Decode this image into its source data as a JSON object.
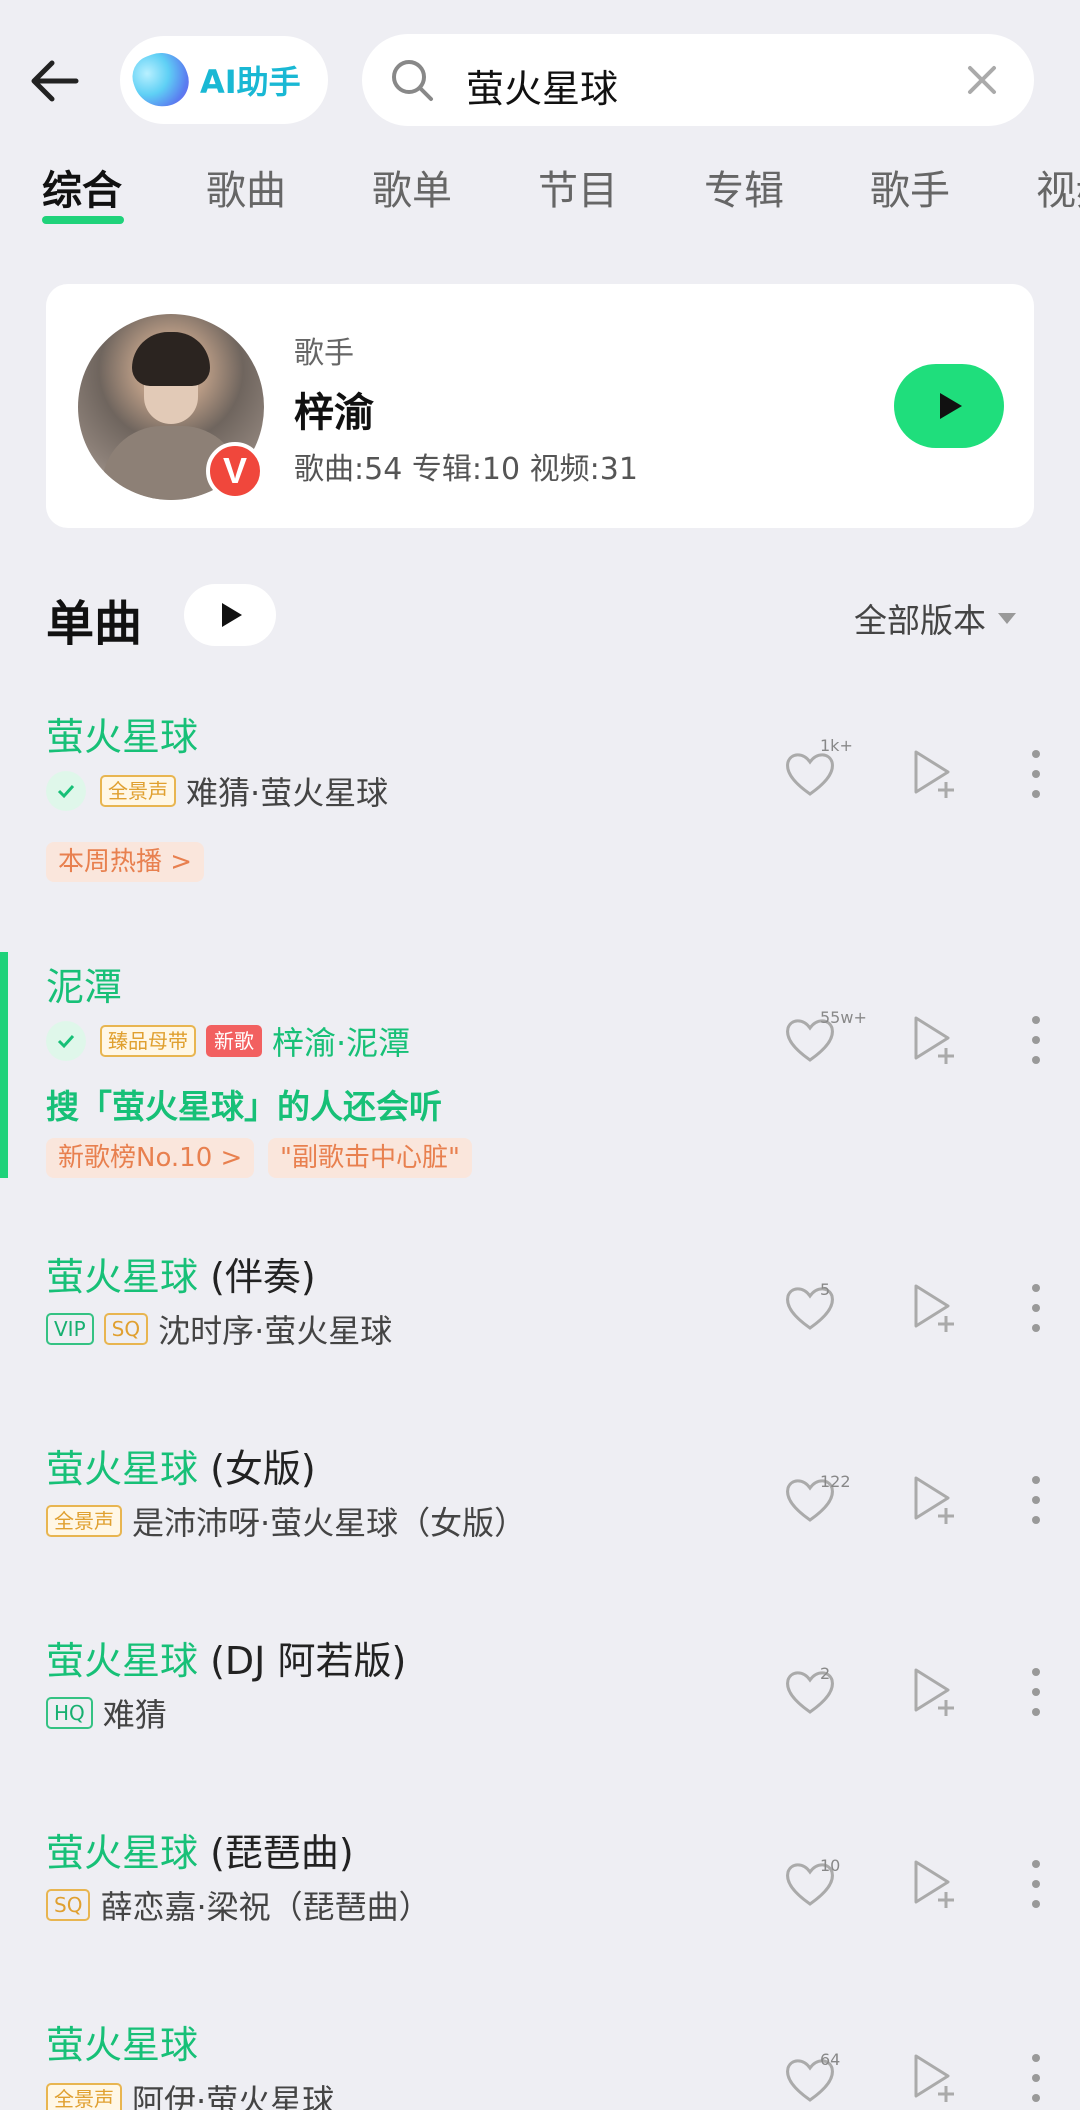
{
  "header": {
    "ai_label": "AI助手",
    "search_value": "萤火星球"
  },
  "tabs": [
    "综合",
    "歌曲",
    "歌单",
    "节目",
    "专辑",
    "歌手",
    "视频"
  ],
  "artist": {
    "type": "歌手",
    "name": "梓渝",
    "badge": "V",
    "stats": "歌曲:54 专辑:10 视频:31"
  },
  "section": {
    "title": "单曲",
    "version_filter": "全部版本"
  },
  "songs": [
    {
      "title_hl": "萤火星球",
      "title_rest": "",
      "downloaded": true,
      "tags": [
        {
          "text": "全景声",
          "style": "gold"
        }
      ],
      "meta": "难猜·萤火星球",
      "chips": [
        "本周热播 >"
      ],
      "like_count": "1k+"
    },
    {
      "title_hl": "泥潭",
      "title_rest": "",
      "downloaded": true,
      "tags": [
        {
          "text": "臻品母带",
          "style": "gold"
        },
        {
          "text": "新歌",
          "style": "red"
        }
      ],
      "meta": "梓渝·泥潭",
      "also": "搜「萤火星球」的人还会听",
      "chips": [
        "新歌榜No.10 >",
        "\"副歌击中心脏\""
      ],
      "like_count": "55w+"
    },
    {
      "title_hl": "萤火星球",
      "title_rest": " (伴奏)",
      "tags": [
        {
          "text": "VIP",
          "style": "green"
        },
        {
          "text": "SQ",
          "style": "goldo"
        }
      ],
      "meta": "沈时序·萤火星球",
      "like_count": "5"
    },
    {
      "title_hl": "萤火星球",
      "title_rest": " (女版)",
      "tags": [
        {
          "text": "全景声",
          "style": "gold"
        }
      ],
      "meta": "是沛沛呀·萤火星球（女版）",
      "like_count": "122"
    },
    {
      "title_hl": "萤火星球",
      "title_rest": " (DJ 阿若版)",
      "tags": [
        {
          "text": "HQ",
          "style": "green"
        }
      ],
      "meta": "难猜",
      "like_count": "2"
    },
    {
      "title_hl": "萤火星球",
      "title_rest": " (琵琶曲)",
      "tags": [
        {
          "text": "SQ",
          "style": "goldo"
        }
      ],
      "meta": "薛恋嘉·梁祝（琵琶曲）",
      "like_count": "10"
    },
    {
      "title_hl": "萤火星球",
      "title_rest": "",
      "tags": [
        {
          "text": "全景声",
          "style": "gold"
        }
      ],
      "meta": "阿伊·萤火星球",
      "like_count": "64"
    }
  ],
  "colors": {
    "accent": "#1fd27a",
    "green_text": "#17c077",
    "background": "#eeeef3"
  },
  "icons": [
    "back-arrow-icon",
    "ai-orb-icon",
    "search-icon",
    "close-icon",
    "play-icon",
    "heart-icon",
    "add-to-playlist-icon",
    "more-vertical-icon",
    "check-icon"
  ]
}
